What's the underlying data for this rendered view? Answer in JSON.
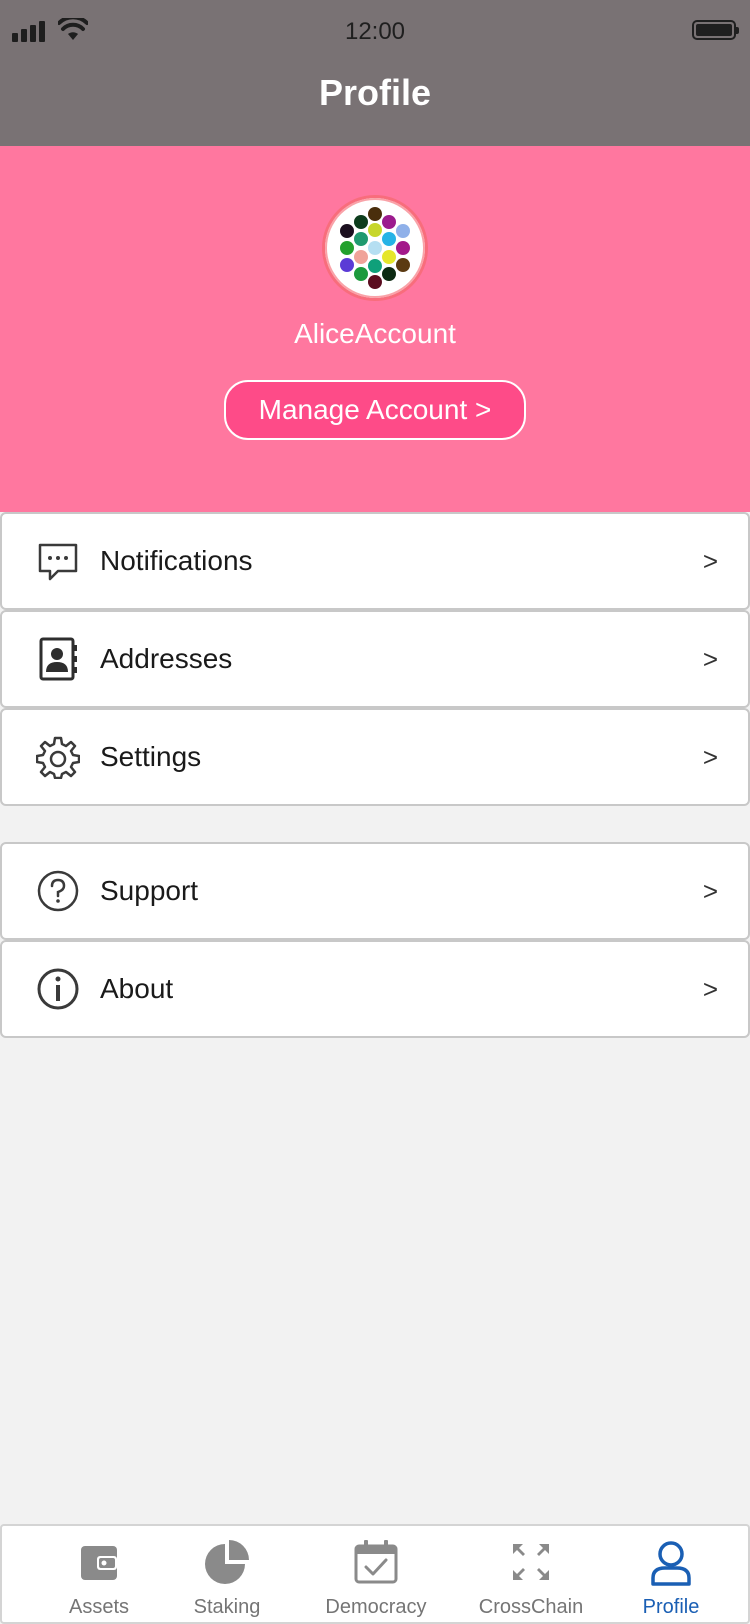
{
  "status_bar": {
    "time": "12:00"
  },
  "header": {
    "title": "Profile"
  },
  "profile": {
    "account_name": "AliceAccount",
    "manage_button_label": "Manage Account >"
  },
  "menu_groups": [
    {
      "items": [
        {
          "label": "Notifications",
          "icon": "chat-bubble-icon",
          "chevron": ">"
        },
        {
          "label": "Addresses",
          "icon": "contact-book-icon",
          "chevron": ">"
        },
        {
          "label": "Settings",
          "icon": "gear-icon",
          "chevron": ">"
        }
      ]
    },
    {
      "items": [
        {
          "label": "Support",
          "icon": "question-circle-icon",
          "chevron": ">"
        },
        {
          "label": "About",
          "icon": "info-circle-icon",
          "chevron": ">"
        }
      ]
    }
  ],
  "tab_bar": {
    "tabs": [
      {
        "label": "Assets",
        "icon": "wallet-icon",
        "active": false
      },
      {
        "label": "Staking",
        "icon": "pie-chart-icon",
        "active": false
      },
      {
        "label": "Democracy",
        "icon": "calendar-check-icon",
        "active": false
      },
      {
        "label": "CrossChain",
        "icon": "expand-arrows-icon",
        "active": false
      },
      {
        "label": "Profile",
        "icon": "person-icon",
        "active": true
      }
    ]
  },
  "colors": {
    "header_bg": "#797274",
    "hero_bg": "#ff779f",
    "button_bg": "#fe4b88",
    "active_tab": "#1a5fb4",
    "inactive_tab": "#757575"
  }
}
